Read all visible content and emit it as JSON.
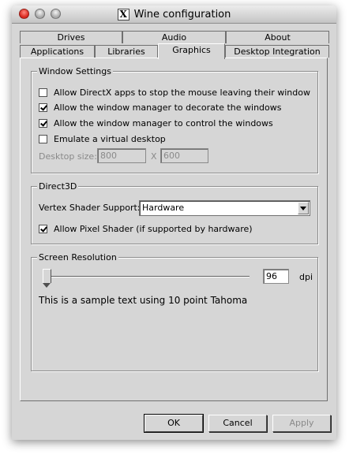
{
  "window": {
    "title": "Wine configuration",
    "app_icon": "X"
  },
  "tabs_row1": [
    {
      "label": "Drives"
    },
    {
      "label": "Audio"
    },
    {
      "label": "About"
    }
  ],
  "tabs_row2": [
    {
      "label": "Applications"
    },
    {
      "label": "Libraries"
    },
    {
      "label": "Graphics",
      "active": true
    },
    {
      "label": "Desktop Integration"
    }
  ],
  "window_settings": {
    "title": "Window Settings",
    "dx_mouse": {
      "label": "Allow DirectX apps to stop the mouse leaving their window",
      "checked": false
    },
    "decorate": {
      "label": "Allow the window manager to decorate the windows",
      "checked": true
    },
    "control": {
      "label": "Allow the window manager to control the windows",
      "checked": true
    },
    "virtual_desktop": {
      "label": "Emulate a virtual desktop",
      "checked": false
    },
    "desktop_size_label": "Desktop size:",
    "desktop_width": "800",
    "separator": "X",
    "desktop_height": "600"
  },
  "direct3d": {
    "title": "Direct3D",
    "vertex_shader_label": "Vertex Shader Support:",
    "vertex_shader_value": "Hardware",
    "pixel_shader": {
      "label": "Allow Pixel Shader (if supported by hardware)",
      "checked": true
    }
  },
  "screen_resolution": {
    "title": "Screen Resolution",
    "dpi_value": "96",
    "dpi_unit": "dpi",
    "slider_fraction": 0.0,
    "sample_text": "This is a sample text using 10 point Tahoma"
  },
  "buttons": {
    "ok": "OK",
    "cancel": "Cancel",
    "apply": "Apply"
  }
}
